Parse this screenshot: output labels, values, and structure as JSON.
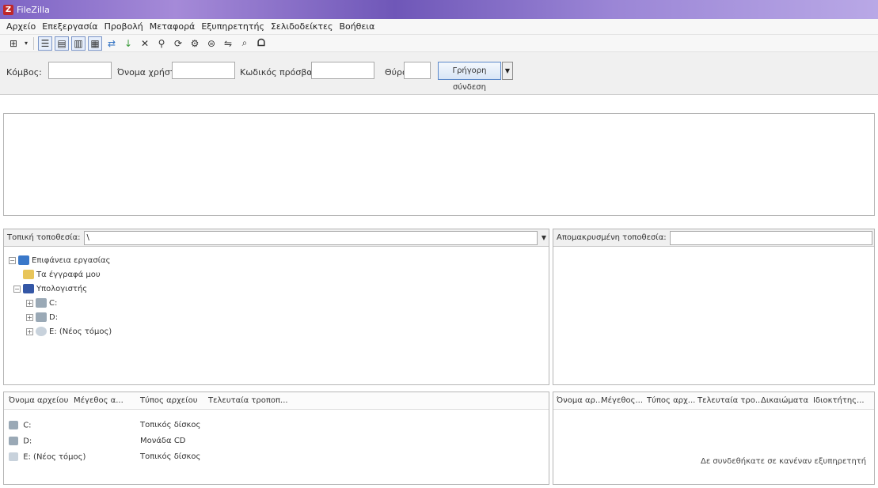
{
  "window": {
    "title": "FileZilla"
  },
  "menu": [
    "Αρχείο",
    "Επεξεργασία",
    "Προβολή",
    "Μεταφορά",
    "Εξυπηρετητής",
    "Σελιδοδείκτες",
    "Βοήθεια"
  ],
  "toolbar": {
    "icons": [
      "site-manager-icon",
      "dropdown-arrow-icon",
      "toggle-log-icon",
      "toggle-tree-icon",
      "toggle-remote-tree-icon",
      "toggle-queue-icon",
      "refresh-icon",
      "process-queue-icon",
      "cancel-icon",
      "disconnect-icon",
      "reconnect-icon",
      "filter-icon",
      "compare-icon",
      "sync-browse-icon",
      "search-icon"
    ]
  },
  "quickconnect": {
    "host_label": "Κόμβος:",
    "user_label": "Όνομα χρήστη:",
    "password_label": "Κωδικός πρόσβασης:",
    "port_label": "Θύρα:",
    "host_value": "",
    "user_value": "",
    "password_value": "",
    "port_value": "",
    "connect_label": "Γρήγορη σύνδεση"
  },
  "local": {
    "site_label": "Τοπική τοποθεσία:",
    "site_value": "\\",
    "tree": [
      {
        "label": "Επιφάνεια εργασίας",
        "icon": "desktop",
        "level": 0,
        "expander": "−"
      },
      {
        "label": "Τα έγγραφά μου",
        "icon": "folder",
        "level": 1,
        "expander": ""
      },
      {
        "label": "Υπολογιστής",
        "icon": "computer",
        "level": 1,
        "expander": "−"
      },
      {
        "label": "C:",
        "icon": "drive",
        "level": 2,
        "expander": "+"
      },
      {
        "label": "D:",
        "icon": "drive",
        "level": 2,
        "expander": "+"
      },
      {
        "label": "E: (Νέος τόμος)",
        "icon": "optical",
        "level": 2,
        "expander": "+"
      }
    ],
    "columns": [
      "Όνομα αρχείου",
      "Μέγεθος α...",
      "Τύπος αρχείου",
      "Τελευταία τροποπ..."
    ],
    "rows": [
      {
        "name": "C:",
        "type": "Τοπικός δίσκος",
        "icon": "drive"
      },
      {
        "name": "D:",
        "type": "Μονάδα CD",
        "icon": "drive"
      },
      {
        "name": "E: (Νέος τόμος)",
        "type": "Τοπικός δίσκος",
        "icon": "optical"
      }
    ]
  },
  "remote": {
    "site_label": "Απομακρυσμένη τοποθεσία:",
    "site_value": "",
    "columns": [
      "Όνομα αρ...",
      "Μέγεθος...",
      "Τύπος αρχ...",
      "Τελευταία τρο...",
      "Δικαιώματα",
      "Ιδιοκτήτης..."
    ],
    "status": "Δε συνδεθήκατε σε κανέναν εξυπηρετητή"
  },
  "colors": {
    "titlebar": "#7d64c4",
    "accent": "#5b88c9"
  }
}
